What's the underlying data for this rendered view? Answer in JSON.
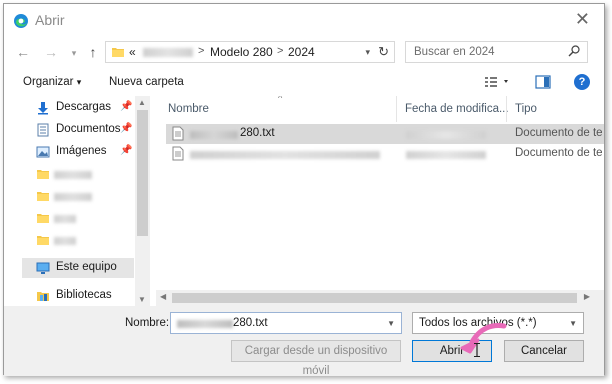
{
  "window": {
    "title": "Abrir"
  },
  "address_bar": {
    "overflow": "«",
    "crumbs": [
      "Modelo 280",
      "2024"
    ],
    "separator": ">"
  },
  "search": {
    "placeholder": "Buscar en 2024"
  },
  "toolbar": {
    "organize": "Organizar",
    "new_folder": "Nueva carpeta"
  },
  "nav_pane": {
    "items": [
      {
        "label": "Descargas",
        "icon": "download-icon"
      },
      {
        "label": "Documentos",
        "icon": "document-icon"
      },
      {
        "label": "Imágenes",
        "icon": "images-icon"
      },
      {
        "label": "Este equipo",
        "icon": "computer-icon"
      },
      {
        "label": "Bibliotecas",
        "icon": "library-icon"
      }
    ]
  },
  "file_list": {
    "columns": [
      "Nombre",
      "Fecha de modifica...",
      "Tipo"
    ],
    "rows": [
      {
        "name_suffix": "280.txt",
        "type": "Documento de te"
      },
      {
        "name_suffix": "",
        "type": "Documento de te"
      }
    ]
  },
  "footer": {
    "filename_label": "Nombre:",
    "filename_suffix": "280.txt",
    "filetype": "Todos los archivos (*.*)",
    "device_button": "Cargar desde un dispositivo móvil",
    "open_button": "Abrir",
    "cancel_button": "Cancelar"
  },
  "colors": {
    "accent": "#0078d7",
    "help": "#1f6fd0",
    "annotation_arrow": "#e86ab8"
  }
}
